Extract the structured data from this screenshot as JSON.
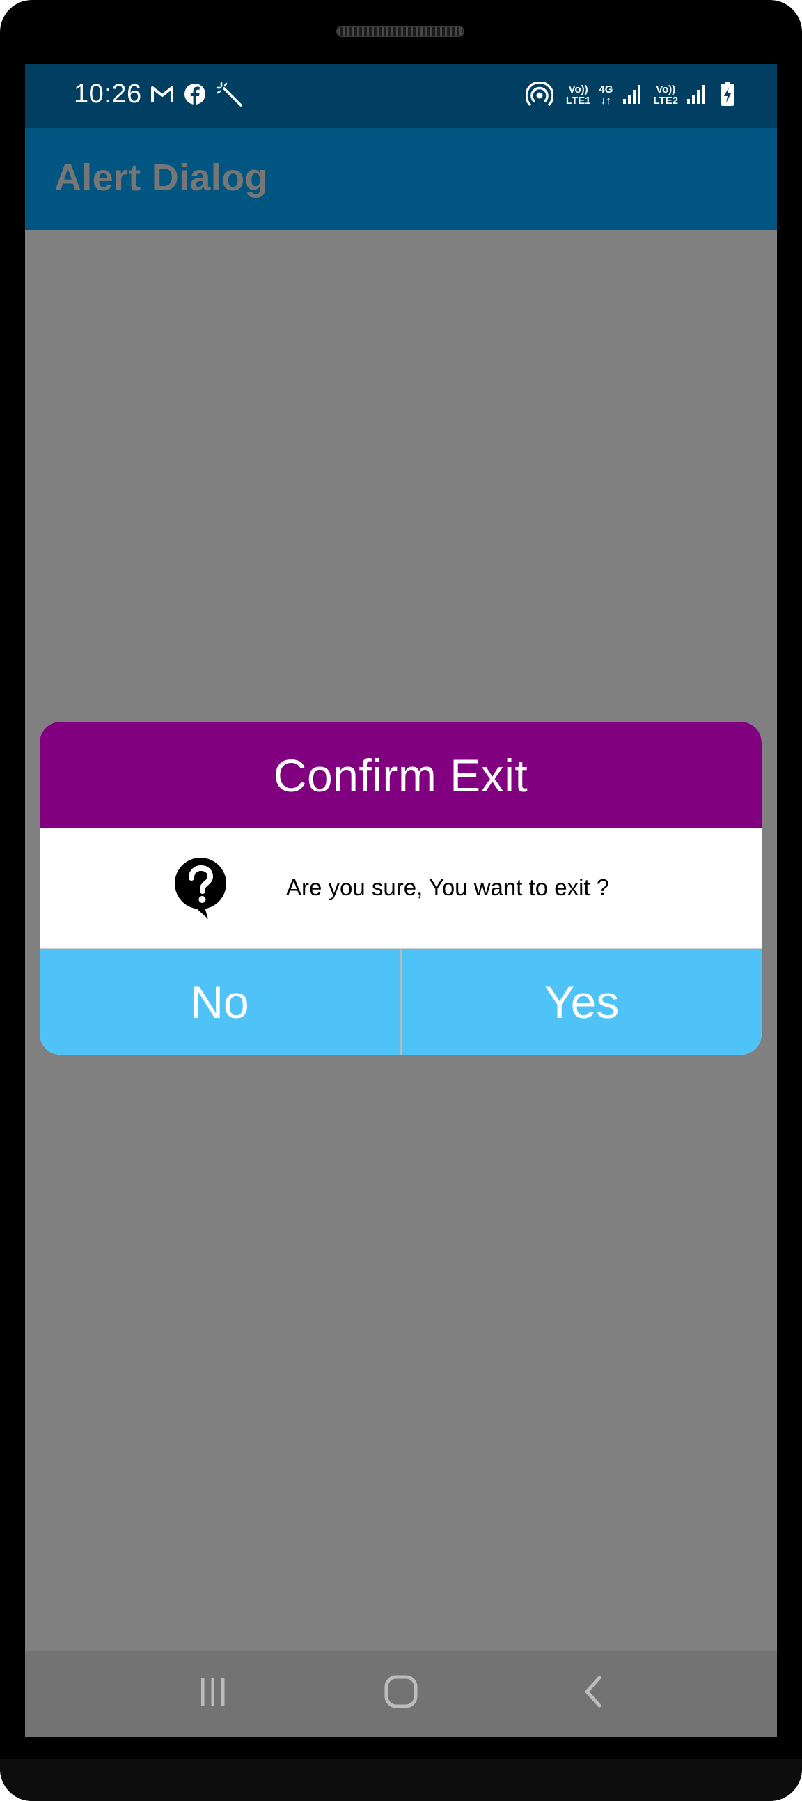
{
  "status_bar": {
    "time": "10:26",
    "left_icons": [
      "gmail-icon",
      "facebook-icon",
      "magic-wand-icon"
    ],
    "right_icons": [
      "hotspot-icon",
      "volte-lte1-icon",
      "4g-data-icon",
      "signal-icon",
      "volte-lte2-icon",
      "signal-icon",
      "battery-charging-icon"
    ],
    "sim1_top": "Vo))",
    "sim1_bottom": "LTE1",
    "data_top": "4G",
    "data_bottom": "↓↑",
    "sim2_top": "Vo))",
    "sim2_bottom": "LTE2"
  },
  "app_bar": {
    "title": "Alert Dialog"
  },
  "dialog": {
    "title": "Confirm Exit",
    "icon": "question-bubble-icon",
    "message": "Are you sure, You want to exit ?",
    "negative_label": "No",
    "positive_label": "Yes"
  },
  "nav_bar": {
    "buttons": [
      "recents-icon",
      "home-icon",
      "back-icon"
    ]
  },
  "colors": {
    "status_bar": "#003f61",
    "app_bar": "#005680",
    "scrim": "#808080",
    "dialog_header": "#800080",
    "dialog_buttons": "#4fc3f7",
    "nav_bar": "#737373"
  }
}
